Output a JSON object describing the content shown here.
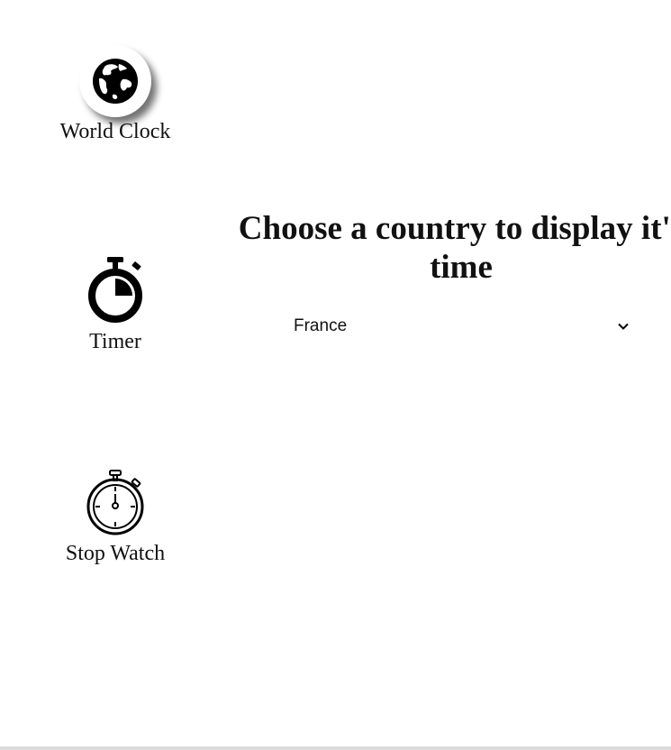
{
  "sidebar": {
    "items": [
      {
        "label": "World Clock",
        "icon": "globe-icon",
        "active": true
      },
      {
        "label": "Timer",
        "icon": "timer-icon",
        "active": false
      },
      {
        "label": "Stop Watch",
        "icon": "stopwatch-icon",
        "active": false
      }
    ]
  },
  "main": {
    "heading": "Choose a country to display it's time",
    "country_select": {
      "value": "France",
      "icon": "chevron-down-icon"
    }
  },
  "colors": {
    "text": "#111111",
    "background": "#ffffff",
    "icon": "#000000"
  }
}
